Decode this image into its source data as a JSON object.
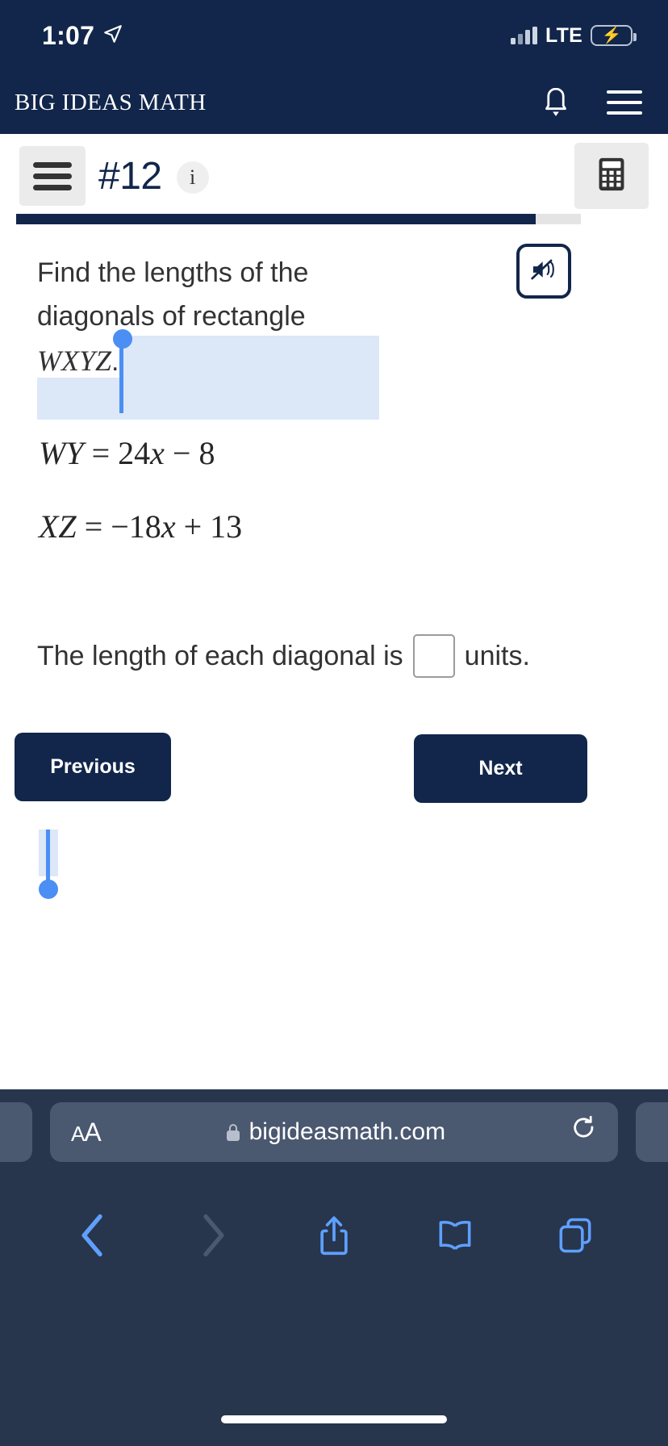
{
  "status_bar": {
    "time": "1:07",
    "location_icon": "location-arrow-icon",
    "signal_icon": "cellular-bars-icon",
    "network": "LTE",
    "battery_icon": "battery-charging-icon"
  },
  "app_header": {
    "brand": "BIG IDEAS MATH",
    "notification_icon": "bell-icon",
    "menu_icon": "hamburger-menu-icon"
  },
  "question_toolbar": {
    "menu_icon": "hamburger-menu-icon",
    "question_number": "#12",
    "info_label": "i",
    "info_icon": "info-icon",
    "calculator_icon": "calculator-icon"
  },
  "progress": {
    "percent": 92
  },
  "question": {
    "prompt_part1": "Find the lengths of the diagonals of rectangle ",
    "prompt_variable": "WXYZ",
    "prompt_part2": ".",
    "audio_icon": "speaker-mute-icon",
    "equations": [
      {
        "lhs": "WY",
        "eq": "=",
        "rhs_coeff": "24",
        "rhs_var": "x",
        "rhs_op": "−",
        "rhs_const": "8"
      },
      {
        "lhs": "XZ",
        "eq": "=",
        "rhs_coeff": "−18",
        "rhs_var": "x",
        "rhs_op": "+",
        "rhs_const": "13"
      }
    ],
    "answer_prefix": "The length of each diagonal is",
    "answer_value": "",
    "answer_suffix": "units."
  },
  "navigation": {
    "previous_label": "Previous",
    "next_label": "Next"
  },
  "browser": {
    "text_size_label_small": "A",
    "text_size_label_large": "A",
    "lock_icon": "lock-icon",
    "url": "bigideasmath.com",
    "reload_icon": "reload-icon",
    "back_icon": "chevron-left-icon",
    "forward_icon": "chevron-right-icon",
    "share_icon": "share-icon",
    "bookmarks_icon": "book-icon",
    "tabs_icon": "tabs-icon"
  },
  "colors": {
    "brand_navy": "#12264b",
    "selection_blue": "#4b8ef4",
    "selection_highlight": "#dce7f8",
    "safari_chrome": "#27354d",
    "safari_field": "#4a5870",
    "safari_accent": "#5ea0ff",
    "battery_green": "#33c759"
  }
}
